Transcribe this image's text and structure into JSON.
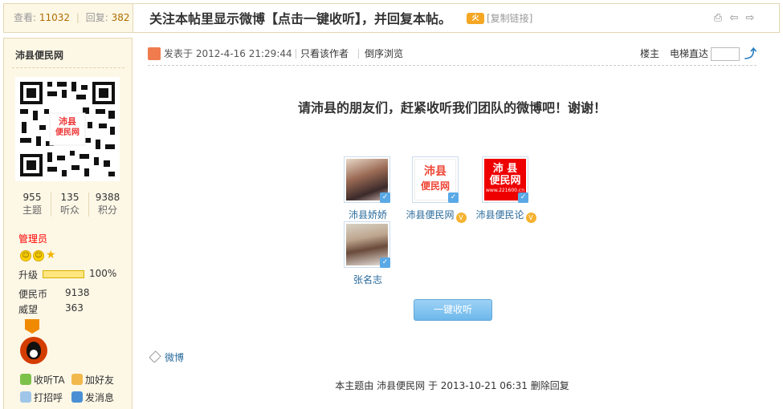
{
  "header": {
    "views_label": "查看:",
    "views": "11032",
    "replies_label": "回复:",
    "replies": "382",
    "title": "关注本帖里显示微博【点击一键收听】，并回复本帖。",
    "copy_link": "[复制链接]"
  },
  "sidebar": {
    "author": "沛县便民网",
    "qr_caption_line1": "沛县",
    "qr_caption_line2": "便民网",
    "stats": [
      {
        "value": "955",
        "label": "主题"
      },
      {
        "value": "135",
        "label": "听众"
      },
      {
        "value": "9388",
        "label": "积分"
      }
    ],
    "group": "管理员",
    "upgrade_label": "升级",
    "upgrade_progress": 1.0,
    "upgrade_pct": "100%",
    "fields": [
      {
        "key": "便民币",
        "value": "9138"
      },
      {
        "key": "威望",
        "value": "363"
      }
    ],
    "actions": [
      {
        "label": "收听TA"
      },
      {
        "label": "加好友"
      },
      {
        "label": "打招呼"
      },
      {
        "label": "发消息"
      }
    ]
  },
  "post": {
    "date": "发表于 2012-4-16 21:29:44",
    "only_author": "只看该作者",
    "reverse": "倒序浏览",
    "floor": "楼主",
    "elevator": "电梯直达",
    "heading": "请沛县的朋友们，赶紧收听我们团队的微博吧！谢谢！",
    "weibo_users": [
      {
        "name": "沛县娇娇"
      },
      {
        "name": "沛县便民网",
        "logo_line1": "沛县",
        "logo_line2": "便民网"
      },
      {
        "name": "沛县便民论",
        "logo_line1": "沛 县",
        "logo_line2": "便民网",
        "logo_line3": "www.221600.cn"
      },
      {
        "name": "张名志"
      }
    ],
    "follow_all": "一键收听",
    "tag": "微博",
    "footer_prefix": "本主题由",
    "footer_user": "沛县便民网",
    "footer_mid": "于 2013-10-21 06:31",
    "footer_action": "删除回复"
  },
  "colors": {
    "accent": "#b06d00",
    "sidebar_bg": "#fdf7e6",
    "link": "#2a6b9c",
    "group": "#ff0000"
  }
}
